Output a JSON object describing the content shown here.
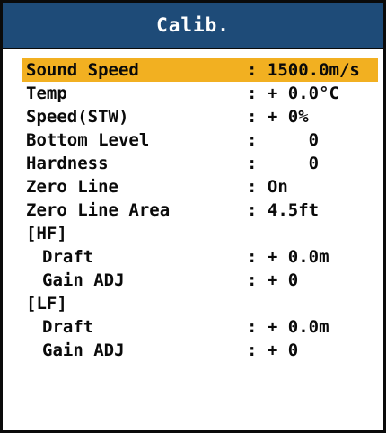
{
  "title": "Calib.",
  "rows": [
    {
      "label": "Sound Speed",
      "value": ": 1500.0m/s"
    },
    {
      "label": "Temp",
      "value": ": + 0.0°C"
    },
    {
      "label": "Speed(STW)",
      "value": ": + 0%"
    },
    {
      "label": "Bottom Level",
      "value": ":     0"
    },
    {
      "label": "Hardness",
      "value": ":     0"
    },
    {
      "label": "Zero Line",
      "value": ": On"
    },
    {
      "label": "Zero Line Area",
      "value": ": 4.5ft"
    },
    {
      "label": "[HF]",
      "value": ""
    },
    {
      "label": "Draft",
      "value": ": + 0.0m"
    },
    {
      "label": "Gain ADJ",
      "value": ": + 0"
    },
    {
      "label": "[LF]",
      "value": ""
    },
    {
      "label": "Draft",
      "value": ": + 0.0m"
    },
    {
      "label": "Gain ADJ",
      "value": ": + 0"
    }
  ],
  "selected_index": 0,
  "colors": {
    "title_bg": "#1e4b78",
    "highlight": "#f2b021",
    "text": "#0a0a0a"
  }
}
